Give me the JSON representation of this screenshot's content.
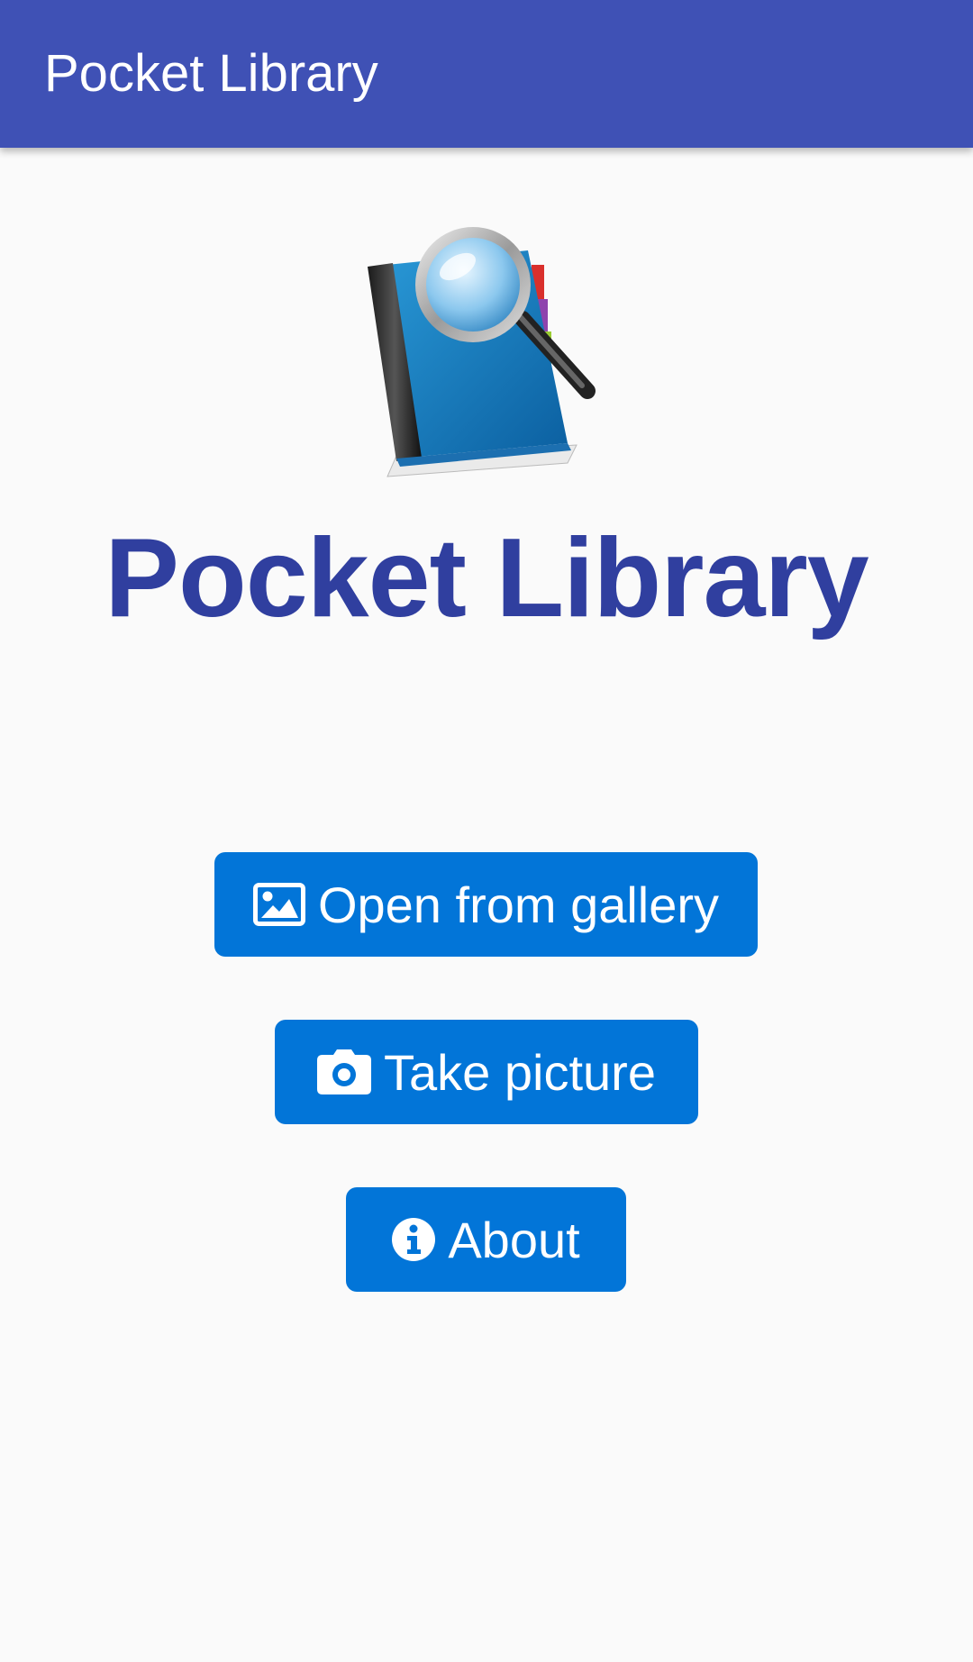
{
  "app_bar": {
    "title": "Pocket Library"
  },
  "main": {
    "logo_icon": "book-with-magnifier-icon",
    "hero_title": "Pocket Library",
    "buttons": [
      {
        "label": "Open from gallery",
        "icon": "image-icon"
      },
      {
        "label": "Take picture",
        "icon": "camera-icon"
      },
      {
        "label": "About",
        "icon": "info-icon"
      }
    ]
  },
  "colors": {
    "app_bar": "#3f51b5",
    "title_text": "#303f9f",
    "button": "#0275d8",
    "background": "#fafafa"
  }
}
